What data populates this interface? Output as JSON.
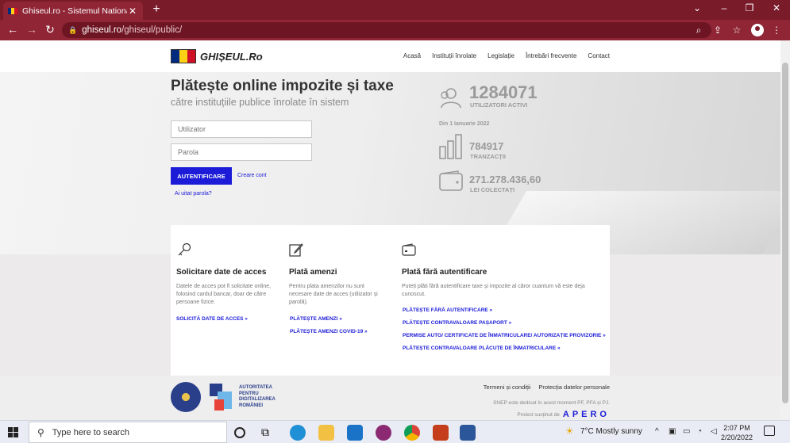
{
  "browser": {
    "tab_title": "Ghiseul.ro - Sistemul National El",
    "tab_close": "✕",
    "new_tab": "+",
    "url_host": "ghiseul.ro",
    "url_path": "/ghiseul/public/",
    "icons": [
      "back-arrow-icon",
      "forward-arrow-icon",
      "reload-icon",
      "lock-icon",
      "zoom-icon",
      "share-icon",
      "bookmark-star-icon",
      "profile-icon",
      "kebab-menu-icon"
    ]
  },
  "header": {
    "logo_text": "GHIȘEUL.Ro",
    "menu": [
      "Acasă",
      "Instituții înrolate",
      "Legislație",
      "Întrebări frecvente",
      "Contact"
    ]
  },
  "hero": {
    "title": "Plătește online impozite și taxe",
    "subtitle": "către instituțiile publice înrolate în sistem",
    "username_placeholder": "Utilizator",
    "password_placeholder": "Parola",
    "login_button": "AUTENTIFICARE",
    "create_account": "Creare cont",
    "forgot_password": "Ai uitat parola?"
  },
  "stats": {
    "active_users": "1284071",
    "active_users_label": "UTILIZATORI ACTIVI",
    "since": "Din 1 Ianuarie 2022",
    "transactions": "784917",
    "transactions_label": "TRANZACȚII",
    "collected": "271.278.436,60",
    "collected_label": "LEI COLECTAȚI"
  },
  "cards": [
    {
      "title": "Solicitare date de acces",
      "text": "Datele de acces pot fi solicitate online, folosind cardul bancar, doar de către persoane fizice.",
      "links": [
        "SOLICITĂ DATE DE ACCES »"
      ]
    },
    {
      "title": "Plată amenzi",
      "text": "Pentru plata amenzilor nu sunt necesare date de acces (utilizator și parolă).",
      "links": [
        "PLĂTEȘTE AMENZI »",
        "PLĂTEȘTE AMENZI COVID-19 »"
      ]
    },
    {
      "title": "Plată fără autentificare",
      "text": "Puteți plăti fără autentificare taxe și impozite al căror cuantum vă este deja cunoscut.",
      "links": [
        "PLĂTEȘTE FĂRĂ AUTENTIFICARE »",
        "PLĂTEȘTE CONTRAVALOARE PAȘAPORT »",
        "PERMISE AUTO/ CERTIFICATE DE ÎNMATRICULARE/ AUTORIZAȚIE PROVIZORIE »",
        "PLĂTEȘTE CONTRAVALOARE PLĂCUȚE DE ÎNMATRICULARE »"
      ]
    }
  ],
  "footer": {
    "adr_lines": [
      "AUTORITATEA",
      "PENTRU",
      "DIGITALIZAREA",
      "ROMÂNIEI"
    ],
    "links": [
      "Termeni și condiții",
      "Protecția datelor personale"
    ],
    "snep": "SNEP este dedicat în acest moment PF, PFA și PJ.",
    "supported_by": "Proiect susținut de",
    "apero": "APERO"
  },
  "taskbar": {
    "search_placeholder": "Type here to search",
    "weather": "7°C  Mostly sunny",
    "time": "2:07 PM",
    "date": "2/20/2022"
  },
  "colors": {
    "browser_frame": "#7a1b2a",
    "accent_blue": "#1b1bd8",
    "flag_blue": "#002b7f",
    "flag_yellow": "#fcd116",
    "flag_red": "#ce1126"
  }
}
